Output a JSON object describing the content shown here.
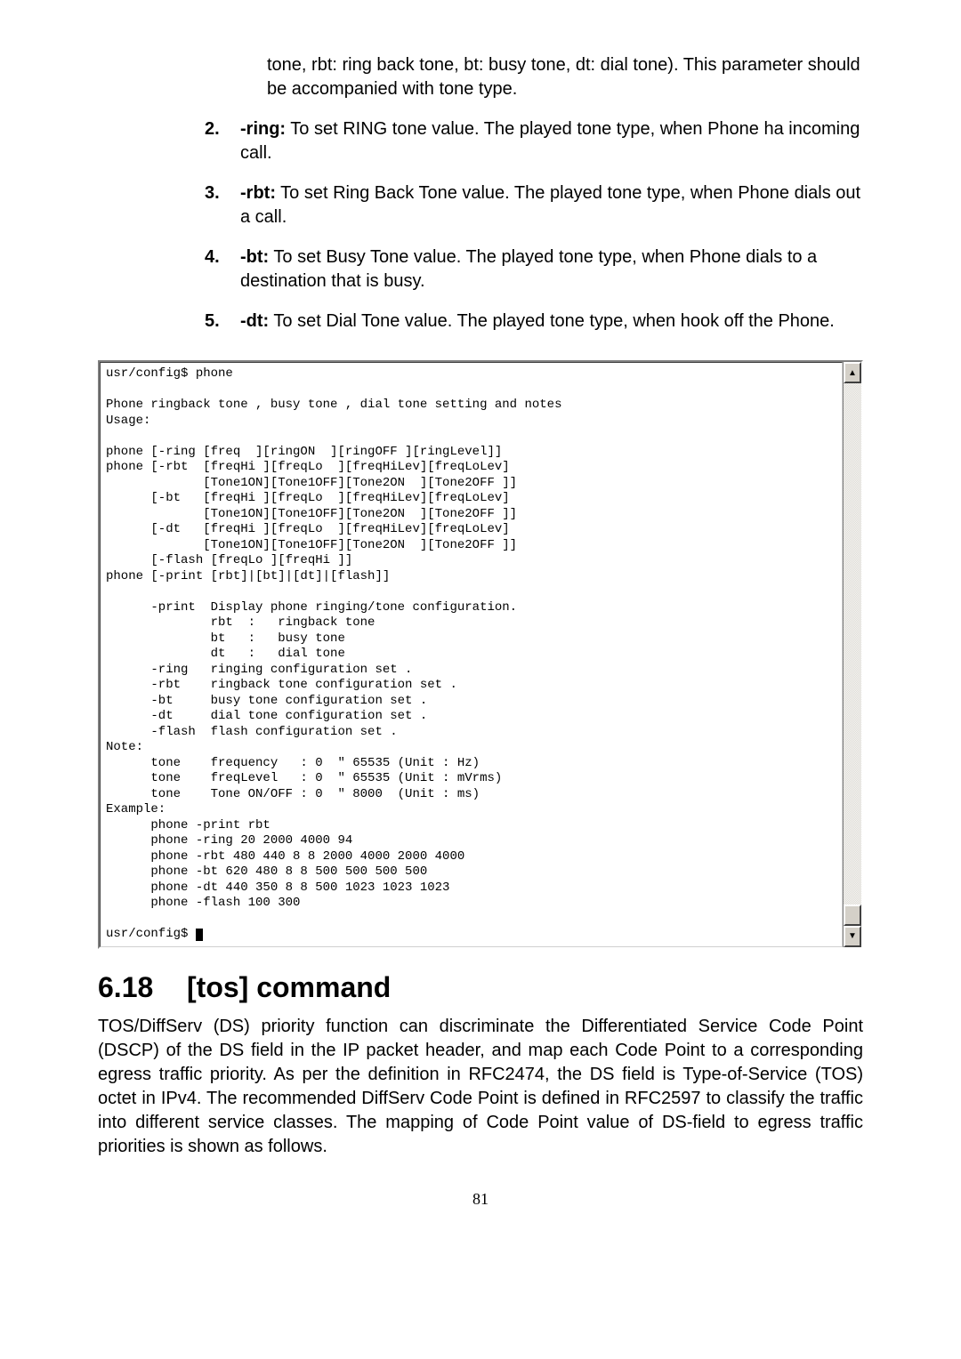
{
  "intro": "tone, rbt: ring back tone, bt: busy tone, dt: dial tone). This parameter should be accompanied with tone type.",
  "items": [
    {
      "num": "2.",
      "label": "-ring:",
      "text": " To set RING tone value. The played tone type, when Phone ha incoming call."
    },
    {
      "num": "3.",
      "label": "-rbt:",
      "text": " To set Ring Back Tone value. The played tone type, when Phone dials out a call."
    },
    {
      "num": "4.",
      "label": "-bt:",
      "text": " To set Busy Tone value. The played tone type, when Phone dials to a destination that is busy."
    },
    {
      "num": "5.",
      "label": "-dt:",
      "text": " To set Dial Tone value. The played tone type, when hook off the Phone."
    }
  ],
  "terminal": "usr/config$ phone\n\nPhone ringback tone , busy tone , dial tone setting and notes\nUsage:\n\nphone [-ring [freq  ][ringON  ][ringOFF ][ringLevel]]\nphone [-rbt  [freqHi ][freqLo  ][freqHiLev][freqLoLev]\n             [Tone1ON][Tone1OFF][Tone2ON  ][Tone2OFF ]]\n      [-bt   [freqHi ][freqLo  ][freqHiLev][freqLoLev]\n             [Tone1ON][Tone1OFF][Tone2ON  ][Tone2OFF ]]\n      [-dt   [freqHi ][freqLo  ][freqHiLev][freqLoLev]\n             [Tone1ON][Tone1OFF][Tone2ON  ][Tone2OFF ]]\n      [-flash [freqLo ][freqHi ]]\nphone [-print [rbt]|[bt]|[dt]|[flash]]\n\n      -print  Display phone ringing/tone configuration.\n              rbt  :   ringback tone\n              bt   :   busy tone\n              dt   :   dial tone\n      -ring   ringing configuration set .\n      -rbt    ringback tone configuration set .\n      -bt     busy tone configuration set .\n      -dt     dial tone configuration set .\n      -flash  flash configuration set .\nNote:\n      tone    frequency   : 0  \" 65535 (Unit : Hz)\n      tone    freqLevel   : 0  \" 65535 (Unit : mVrms)\n      tone    Tone ON/OFF : 0  \" 8000  (Unit : ms)\nExample:\n      phone -print rbt\n      phone -ring 20 2000 4000 94\n      phone -rbt 480 440 8 8 2000 4000 2000 4000\n      phone -bt 620 480 8 8 500 500 500 500\n      phone -dt 440 350 8 8 500 1023 1023 1023\n      phone -flash 100 300\n\nusr/config$ ",
  "section": {
    "num": "6.18",
    "title": "[tos] command"
  },
  "body": "TOS/DiffServ (DS) priority function can discriminate the Differentiated Service Code Point (DSCP) of the DS field in the IP packet header, and map each Code Point to a corresponding egress traffic priority. As per the definition in RFC2474, the DS field is Type-of-Service (TOS) octet in IPv4. The recommended DiffServ Code Point is defined in RFC2597 to classify the traffic into different service classes. The mapping of Code Point value of DS-field to egress traffic priorities is shown as follows.",
  "pageNumber": "81",
  "scroll": {
    "up": "▲",
    "down": "▼"
  }
}
